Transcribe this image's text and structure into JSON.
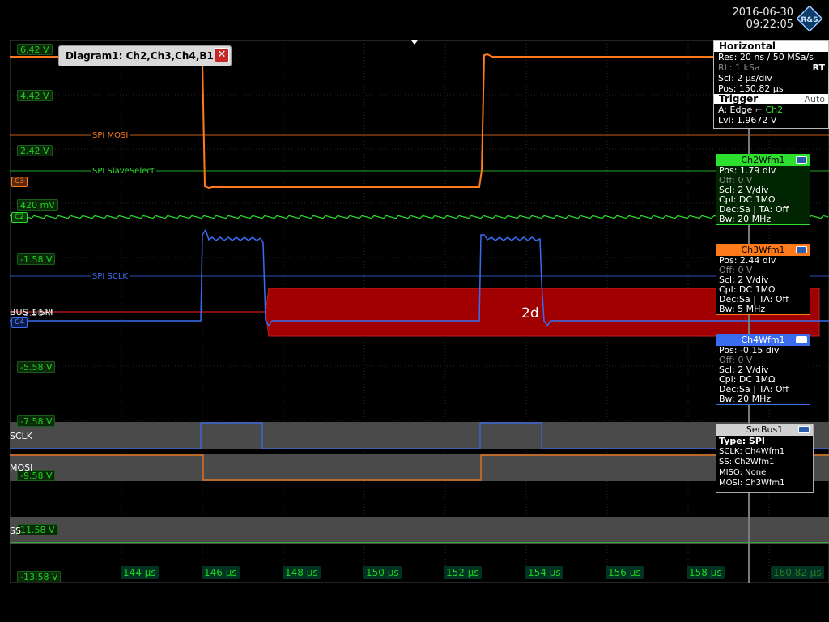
{
  "datetime": {
    "date": "2016-06-30",
    "time": "09:22:05"
  },
  "logo": {
    "text": "R&S"
  },
  "diagram": {
    "title": "Diagram1: Ch2,Ch3,Ch4,B1",
    "close": "✕"
  },
  "y_axis_labels": [
    "6.42 V",
    "4.42 V",
    "2.42 V",
    "420 mV",
    "-1.58 V",
    "-3.58 V",
    "-5.58 V",
    "-7.58 V",
    "-9.58 V",
    "11.58 V",
    "-13.58 V"
  ],
  "x_axis_labels": [
    "144 µs",
    "146 µs",
    "148 µs",
    "150 µs",
    "152 µs",
    "154 µs",
    "156 µs",
    "158 µs",
    "160.82 µs"
  ],
  "signal_labels": {
    "mosi": "SPI MOSI",
    "ss": "SPI SlaveSelect",
    "sclk": "SPI SCLK"
  },
  "markers": {
    "c3": "C3",
    "c2": "C2",
    "c4": "C4",
    "bus": "BUS 1 SPI"
  },
  "bus_frame": {
    "value": "2d"
  },
  "bus_rows": {
    "sclk": "SCLK",
    "mosi": "MOSI",
    "ss": "SS"
  },
  "horizontal": {
    "title": "Horizontal",
    "res": "Res: 20 ns / 50 MSa/s",
    "rl": "RL:  1 kSa",
    "rt": "RT",
    "scl": "Scl:  2 µs/div",
    "pos": "Pos:  150.82 µs",
    "trigger_title": "Trigger",
    "trigger_mode": "Auto",
    "trig_a": "A:   Edge",
    "trig_ch": "Ch2",
    "lvl": "Lvl:  1.9672 V"
  },
  "ch2": {
    "title": "Ch2Wfm1",
    "pos": "Pos: 1.79 div",
    "off": "Off:  0 V",
    "scl": "Scl:  2 V/div",
    "cpl": "Cpl: DC 1MΩ",
    "dec": "Dec:Sa | TA: Off",
    "bw": "Bw: 20 MHz"
  },
  "ch3": {
    "title": "Ch3Wfm1",
    "pos": "Pos: 2.44 div",
    "off": "Off:  0 V",
    "scl": "Scl:  2 V/div",
    "cpl": "Cpl: DC 1MΩ",
    "dec": "Dec:Sa | TA: Off",
    "bw": "Bw: 5 MHz"
  },
  "ch4": {
    "title": "Ch4Wfm1",
    "pos": "Pos: -0.15 div",
    "off": "Off:  0 V",
    "scl": "Scl:  2 V/div",
    "cpl": "Cpl: DC 1MΩ",
    "dec": "Dec:Sa | TA: Off",
    "bw": "Bw: 20 MHz"
  },
  "serbus": {
    "title": "SerBus1",
    "type": "Type: SPI",
    "sclk": "SCLK: Ch4Wfm1",
    "ss": "SS:    Ch2Wfm1",
    "miso": "MISO: None",
    "mosi": "MOSI: Ch3Wfm1"
  },
  "colors": {
    "ch2": "#2ee02e",
    "ch3": "#ff7a1a",
    "ch4": "#3a6cf0",
    "bus": "#a00000",
    "grid": "#3a3a3a",
    "axis": "#1ed21e"
  }
}
